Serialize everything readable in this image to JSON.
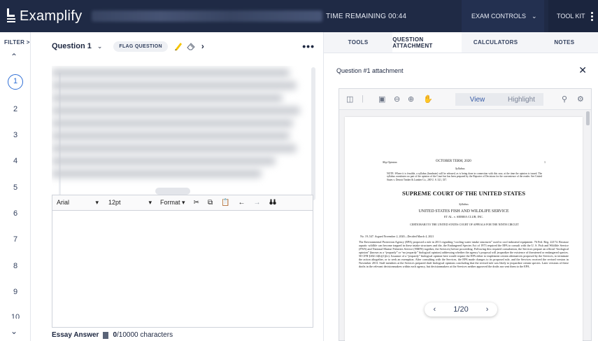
{
  "app": {
    "name": "Examplify"
  },
  "topbar": {
    "time_label": "TIME REMAINING 00:44",
    "exam_controls_label": "EXAM CONTROLS",
    "toolkit_label": "TOOL KIT"
  },
  "qnav": {
    "filter_label": "FILTER >",
    "numbers": [
      "1",
      "2",
      "3",
      "4",
      "5",
      "6",
      "7",
      "8",
      "9",
      "10"
    ],
    "active": "1"
  },
  "question": {
    "title": "Question 1",
    "flag_label": "FLAG QUESTION",
    "more_label": "•••"
  },
  "editor": {
    "font": "Arial",
    "size": "12pt",
    "format": "Format",
    "footer_label": "Essay Answer",
    "count": "0",
    "count_suffix": "/10000 characters"
  },
  "right_panel": {
    "tabs": [
      "TOOLS",
      "QUESTION ATTACHMENT",
      "CALCULATORS",
      "NOTES"
    ],
    "active_tab": "QUESTION ATTACHMENT",
    "attachment_title": "Question #1 attachment"
  },
  "viewer": {
    "view_label": "View",
    "highlight_label": "Highlight",
    "page_indicator": "1/20"
  },
  "document": {
    "header_left": "Slip Opinion",
    "header_center": "OCTOBER TERM, 2020",
    "header_right": "1",
    "syllabus": "Syllabus",
    "note": "NOTE: Where it is feasible, a syllabus (headnote) will be released, as is being done in connection with this case, at the time the opinion is issued. The syllabus constitutes no part of the opinion of the Court but has been prepared by the Reporter of Decisions for the convenience of the reader. See United States v. Detroit Timber & Lumber Co., 200 U. S. 321, 337.",
    "court": "SUPREME COURT OF THE UNITED STATES",
    "syllabus2": "Syllabus",
    "case": "UNITED STATES FISH AND WILDLIFE SERVICE",
    "case_sub": "ET AL. v. SIERRA CLUB, INC.",
    "cert": "CERTIORARI TO THE UNITED STATES COURT OF APPEALS FOR THE NINTH CIRCUIT",
    "docket": "No. 19–547.   Argued November 2, 2020—Decided March 4, 2021",
    "body": "The Environmental Protection Agency (EPA) proposed a rule in 2011 regarding “cooling water intake structures” used to cool industrial equipment. 76 Fed. Reg. 22174. Because aquatic wildlife can become trapped in these intake structures and die, the Endangered Species Act of 1973 required the EPA to consult with the U. S. Fish and Wildlife Service (FWS) and National Marine Fisheries Service (NMFS) together, the Services) before proceeding. Following this required consultation, the Services prepare an official “biological opinion” (known as a “jeopardy” or “no jeopardy” biological opinion) addressing whether the agency’s proposal will jeopardize the existence of threatened or endangered species. 50 CFR §402.14(h)(1)(iv). Issuance of a “jeopardy” biological opinion here would require the EPA either to implement certain alternatives proposed by the Services, to terminate the action altogether, or to seek an exemption. After consulting with the Services, the EPA made changes to its proposed rule, and the Services received the revised version in November 2013. Staff members at the Services prepared draft biological opinions concluding that the revised rule was likely to jeopardize certain species. Later versions of these drafts in the relevant decisionmakers within each agency, but decisionmakers at the Services neither approved the drafts nor sent them to the EPA."
  }
}
